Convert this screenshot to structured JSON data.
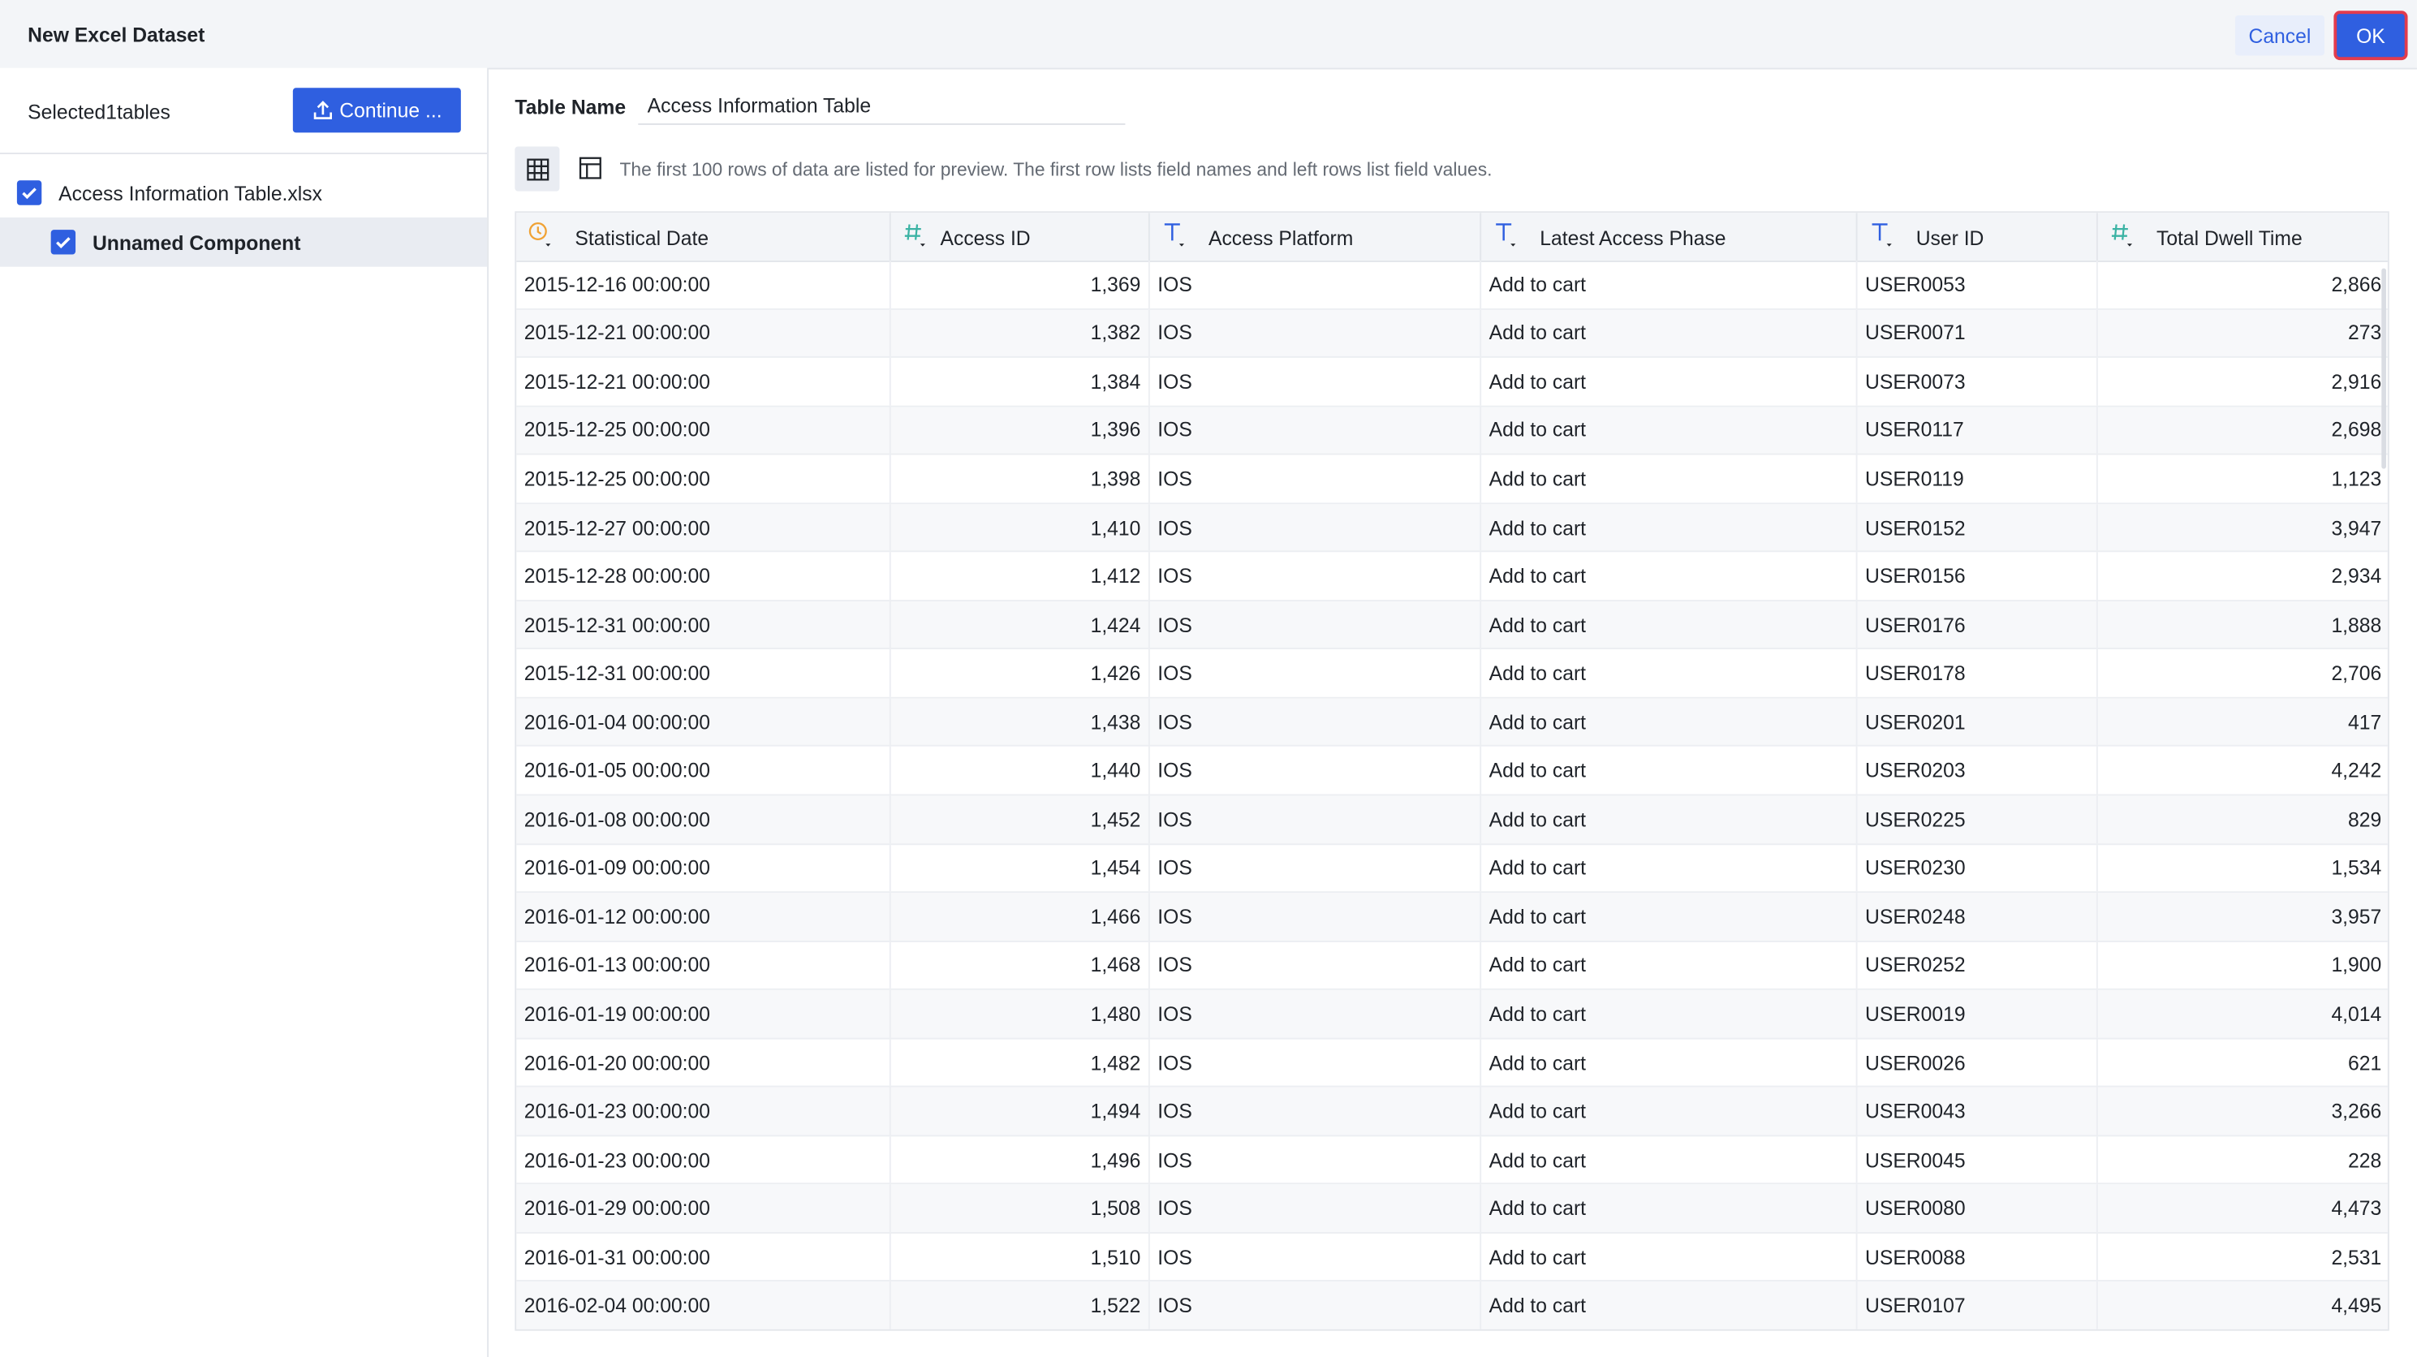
{
  "dialog": {
    "title": "New Excel Dataset",
    "cancel_label": "Cancel",
    "ok_label": "OK"
  },
  "left": {
    "selected_label": "Selected1tables",
    "continue_label": "Continue ...",
    "file_name": "Access Information Table.xlsx",
    "component_name": "Unnamed Component"
  },
  "main": {
    "table_name_label": "Table Name",
    "table_name_value": "Access Information Table",
    "preview_note": "The first 100 rows of data are listed for preview. The first row lists field names and left rows list field values."
  },
  "colors": {
    "accent": "#2f5fe0",
    "ok_outline": "#e23b4d",
    "date_icon": "#f0a234",
    "number_icon": "#3bb3a4",
    "text_icon": "#2f5fe0"
  },
  "table": {
    "columns": [
      {
        "label": "Statistical Date",
        "type": "date",
        "icon": "clock-icon"
      },
      {
        "label": "Access ID",
        "type": "number",
        "icon": "hash-icon"
      },
      {
        "label": "Access Platform",
        "type": "text",
        "icon": "text-type-icon"
      },
      {
        "label": "Latest Access Phase",
        "type": "text",
        "icon": "text-type-icon"
      },
      {
        "label": "User ID",
        "type": "text",
        "icon": "text-type-icon"
      },
      {
        "label": "Total Dwell Time",
        "type": "number",
        "icon": "hash-icon"
      }
    ],
    "rows": [
      [
        "2015-12-16 00:00:00",
        "1,369",
        "IOS",
        "Add to cart",
        "USER0053",
        "2,866"
      ],
      [
        "2015-12-21 00:00:00",
        "1,382",
        "IOS",
        "Add to cart",
        "USER0071",
        "273"
      ],
      [
        "2015-12-21 00:00:00",
        "1,384",
        "IOS",
        "Add to cart",
        "USER0073",
        "2,916"
      ],
      [
        "2015-12-25 00:00:00",
        "1,396",
        "IOS",
        "Add to cart",
        "USER0117",
        "2,698"
      ],
      [
        "2015-12-25 00:00:00",
        "1,398",
        "IOS",
        "Add to cart",
        "USER0119",
        "1,123"
      ],
      [
        "2015-12-27 00:00:00",
        "1,410",
        "IOS",
        "Add to cart",
        "USER0152",
        "3,947"
      ],
      [
        "2015-12-28 00:00:00",
        "1,412",
        "IOS",
        "Add to cart",
        "USER0156",
        "2,934"
      ],
      [
        "2015-12-31 00:00:00",
        "1,424",
        "IOS",
        "Add to cart",
        "USER0176",
        "1,888"
      ],
      [
        "2015-12-31 00:00:00",
        "1,426",
        "IOS",
        "Add to cart",
        "USER0178",
        "2,706"
      ],
      [
        "2016-01-04 00:00:00",
        "1,438",
        "IOS",
        "Add to cart",
        "USER0201",
        "417"
      ],
      [
        "2016-01-05 00:00:00",
        "1,440",
        "IOS",
        "Add to cart",
        "USER0203",
        "4,242"
      ],
      [
        "2016-01-08 00:00:00",
        "1,452",
        "IOS",
        "Add to cart",
        "USER0225",
        "829"
      ],
      [
        "2016-01-09 00:00:00",
        "1,454",
        "IOS",
        "Add to cart",
        "USER0230",
        "1,534"
      ],
      [
        "2016-01-12 00:00:00",
        "1,466",
        "IOS",
        "Add to cart",
        "USER0248",
        "3,957"
      ],
      [
        "2016-01-13 00:00:00",
        "1,468",
        "IOS",
        "Add to cart",
        "USER0252",
        "1,900"
      ],
      [
        "2016-01-19 00:00:00",
        "1,480",
        "IOS",
        "Add to cart",
        "USER0019",
        "4,014"
      ],
      [
        "2016-01-20 00:00:00",
        "1,482",
        "IOS",
        "Add to cart",
        "USER0026",
        "621"
      ],
      [
        "2016-01-23 00:00:00",
        "1,494",
        "IOS",
        "Add to cart",
        "USER0043",
        "3,266"
      ],
      [
        "2016-01-23 00:00:00",
        "1,496",
        "IOS",
        "Add to cart",
        "USER0045",
        "228"
      ],
      [
        "2016-01-29 00:00:00",
        "1,508",
        "IOS",
        "Add to cart",
        "USER0080",
        "4,473"
      ],
      [
        "2016-01-31 00:00:00",
        "1,510",
        "IOS",
        "Add to cart",
        "USER0088",
        "2,531"
      ],
      [
        "2016-02-04 00:00:00",
        "1,522",
        "IOS",
        "Add to cart",
        "USER0107",
        "4,495"
      ]
    ]
  }
}
